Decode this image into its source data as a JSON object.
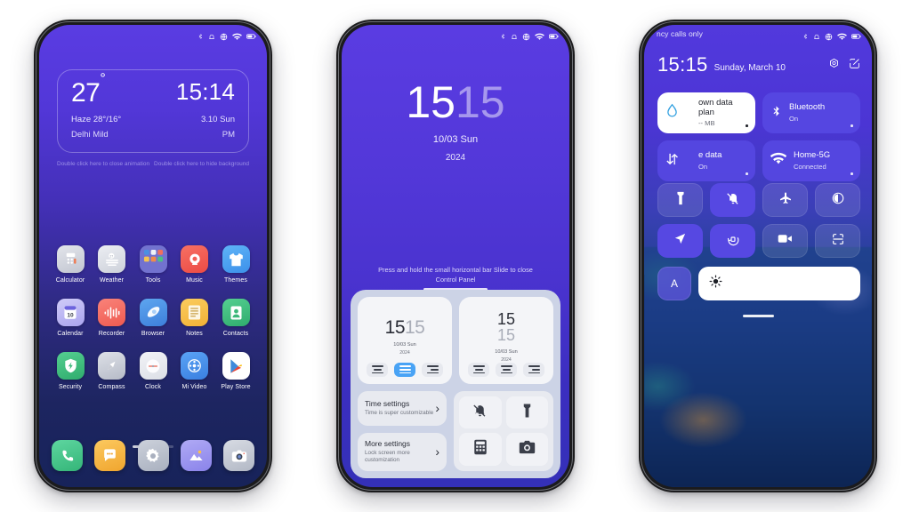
{
  "page": {
    "background": "#ffffff"
  },
  "phone1": {
    "name": "home-screen",
    "statusbar": {
      "icons": [
        "bluetooth-icon",
        "alarm-icon",
        "vpn-globe-icon",
        "wifi-icon",
        "battery-icon"
      ]
    },
    "weather_widget": {
      "temperature": "27",
      "degree": "°",
      "time": "15:14",
      "condition": "Haze 28°/16°",
      "date": "3.10 Sun",
      "location": "Delhi Mild",
      "meridiem": "PM"
    },
    "hints": {
      "left": "Double click here to close animation",
      "right": "Double click here to hide background"
    },
    "apps": [
      [
        {
          "label": "Calculator",
          "icon": "calculator-icon",
          "color": "#c9ccd6"
        },
        {
          "label": "Weather",
          "icon": "weather-icon",
          "color": "#d3d6de"
        },
        {
          "label": "Tools",
          "icon": "tools-folder-icon",
          "color": "#6f6fd0"
        },
        {
          "label": "Music",
          "icon": "music-icon",
          "color": "#f2584f"
        },
        {
          "label": "Themes",
          "icon": "themes-icon",
          "color": "#4aa7f0"
        }
      ],
      [
        {
          "label": "Calendar",
          "icon": "calendar-icon",
          "color": "#b9b6f0"
        },
        {
          "label": "Recorder",
          "icon": "recorder-icon",
          "color": "#f4685e"
        },
        {
          "label": "Browser",
          "icon": "browser-icon",
          "color": "#4b9ae8"
        },
        {
          "label": "Notes",
          "icon": "notes-icon",
          "color": "#f5bd45"
        },
        {
          "label": "Contacts",
          "icon": "contacts-icon",
          "color": "#3fbd7d"
        }
      ],
      [
        {
          "label": "Security",
          "icon": "security-shield-icon",
          "color": "#3fbd7d"
        },
        {
          "label": "Compass",
          "icon": "compass-icon",
          "color": "#c6cad4"
        },
        {
          "label": "Clock",
          "icon": "clock-icon",
          "color": "#e7e9ef"
        },
        {
          "label": "Mi Video",
          "icon": "mi-video-icon",
          "color": "#3f8ef0"
        },
        {
          "label": "Play Store",
          "icon": "play-store-icon",
          "color": "#ffffff"
        }
      ]
    ],
    "page_indicator": {
      "count": 3,
      "active": 0
    },
    "dock": [
      {
        "label": "Phone",
        "icon": "phone-icon",
        "color": "#45c487"
      },
      {
        "label": "Messages",
        "icon": "messages-icon",
        "color": "#f5b63f"
      },
      {
        "label": "Settings",
        "icon": "settings-gear-icon",
        "color": "#b7bdc9"
      },
      {
        "label": "Gallery",
        "icon": "gallery-icon",
        "color": "#9a95ee"
      },
      {
        "label": "Camera",
        "icon": "camera-icon",
        "color": "#c3c7d2"
      }
    ]
  },
  "phone2": {
    "name": "lock-screen-control-panel",
    "statusbar": {
      "icons": [
        "bluetooth-icon",
        "alarm-icon",
        "vpn-globe-icon",
        "wifi-icon",
        "battery-icon"
      ]
    },
    "lock_clock": {
      "time_primary": "15",
      "time_secondary": "15",
      "date": "10/03 Sun",
      "year": "2024"
    },
    "control_hint": {
      "line1": "Press and hold the small horizontal bar Slide to close",
      "line2": "Control Panel"
    },
    "clock_styles": [
      {
        "name": "inline-clock-style",
        "time_primary": "15",
        "time_secondary": "15",
        "date": "10/03 Sun",
        "year": "2024",
        "alignments": [
          "align-left",
          "align-center",
          "align-right"
        ],
        "selected_alignment": 1
      },
      {
        "name": "stacked-clock-style",
        "time_primary": "15",
        "time_secondary": "15",
        "date": "10/03 Sun",
        "year": "2024",
        "alignments": [
          "align-left",
          "align-center",
          "align-right"
        ],
        "selected_alignment": -1
      }
    ],
    "settings_rows": [
      {
        "title": "Time settings",
        "subtitle": "Time is super customizable",
        "chevron": "›"
      },
      {
        "title": "More settings",
        "subtitle": "Lock screen more customization",
        "chevron": "›"
      }
    ],
    "quick_icons": [
      {
        "name": "mute-bell-icon"
      },
      {
        "name": "flashlight-icon"
      },
      {
        "name": "calculator-icon"
      },
      {
        "name": "camera-icon"
      }
    ]
  },
  "phone3": {
    "name": "notification-shade",
    "carrier": "ncy calls only",
    "statusbar": {
      "icons": [
        "bluetooth-icon",
        "alarm-icon",
        "vpn-globe-icon",
        "wifi-icon",
        "battery-icon"
      ]
    },
    "header": {
      "time": "15:15",
      "date": "Sunday, March 10",
      "actions": [
        {
          "name": "settings-icon"
        },
        {
          "name": "edit-icon"
        }
      ]
    },
    "tiles": [
      {
        "name": "data-plan-tile",
        "title": "own data plan",
        "subtitle": "-- MB",
        "icon": "water-drop-icon",
        "active": true
      },
      {
        "name": "bluetooth-tile",
        "title": "Bluetooth",
        "subtitle": "On",
        "icon": "bluetooth-icon",
        "active": false
      },
      {
        "name": "mobile-data-tile",
        "title": "e data",
        "subtitle": "On",
        "icon": "mobile-data-icon",
        "active": false
      },
      {
        "name": "wifi-tile",
        "title": "Home-5G",
        "subtitle": "Connected",
        "icon": "wifi-icon",
        "active": false
      }
    ],
    "toggles": [
      {
        "name": "flashlight-toggle",
        "icon": "flashlight-icon",
        "on": false
      },
      {
        "name": "mute-toggle",
        "icon": "mute-bell-icon",
        "on": true
      },
      {
        "name": "airplane-toggle",
        "icon": "airplane-icon",
        "on": false
      },
      {
        "name": "dark-mode-toggle",
        "icon": "dark-mode-icon",
        "on": false
      },
      {
        "name": "location-toggle",
        "icon": "location-arrow-icon",
        "on": true
      },
      {
        "name": "auto-rotate-toggle",
        "icon": "auto-rotate-icon",
        "on": true
      },
      {
        "name": "screen-record-toggle",
        "icon": "video-camera-icon",
        "on": false
      },
      {
        "name": "scanner-toggle",
        "icon": "scan-frame-icon",
        "on": false
      }
    ],
    "brightness": {
      "auto_label": "A",
      "slider_icon": "sun-brightness-icon",
      "value": 8
    }
  }
}
